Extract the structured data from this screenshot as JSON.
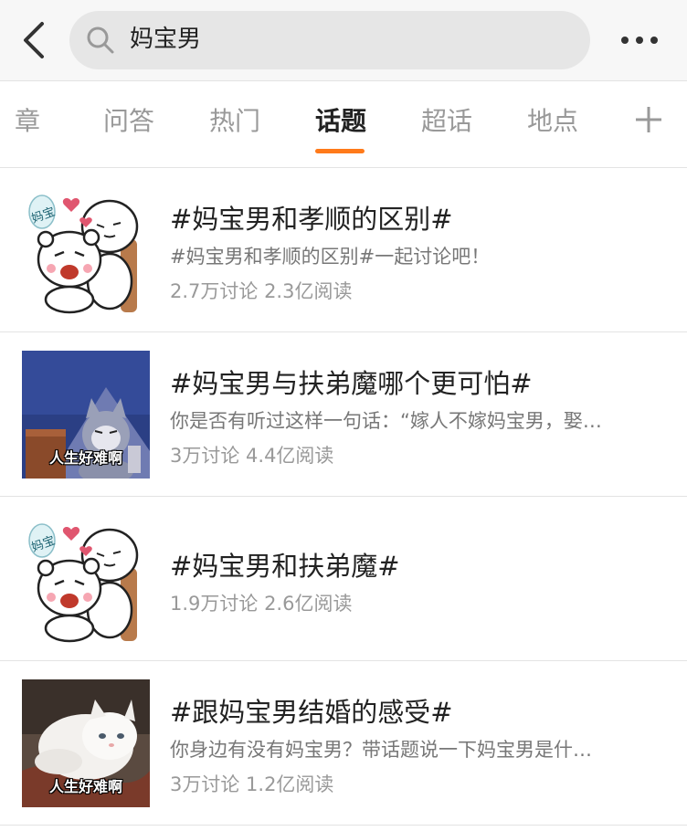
{
  "search": {
    "query": "妈宝男"
  },
  "tabs": [
    {
      "label": "章"
    },
    {
      "label": "问答"
    },
    {
      "label": "热门"
    },
    {
      "label": "话题",
      "active": true
    },
    {
      "label": "超话"
    },
    {
      "label": "地点"
    }
  ],
  "colors": {
    "accent": "#ff7a1a",
    "title": "#222222",
    "meta": "#999999"
  },
  "topics": [
    {
      "title": "#妈宝男和孝顺的区别#",
      "desc": "#妈宝男和孝顺的区别#一起讨论吧！",
      "stats": "2.7万讨论 2.3亿阅读",
      "thumb_icon": "cartoon-bear-sticker",
      "sticker_text": "妈宝"
    },
    {
      "title": "#妈宝男与扶弟魔哪个更可怕#",
      "desc": "你是否有听过这样一句话：“嫁人不嫁妈宝男，娶…",
      "stats": "3万讨论 4.4亿阅读",
      "thumb_icon": "tom-cat-meme",
      "caption": "人生好难啊"
    },
    {
      "title": "#妈宝男和扶弟魔#",
      "stats": "1.9万讨论 2.6亿阅读",
      "thumb_icon": "cartoon-bear-sticker",
      "sticker_text": "妈宝"
    },
    {
      "title": "#跟妈宝男结婚的感受#",
      "desc": "你身边有没有妈宝男？带话题说一下妈宝男是什…",
      "stats": "3万讨论 1.2亿阅读",
      "thumb_icon": "white-cat-photo",
      "caption": "人生好难啊"
    }
  ]
}
